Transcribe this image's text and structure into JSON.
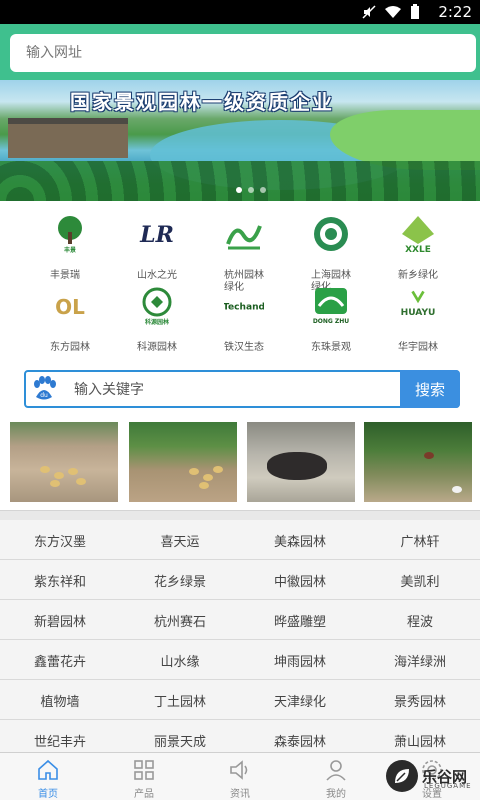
{
  "status_bar": {
    "time": "2:22"
  },
  "url_bar": {
    "placeholder": "输入网址"
  },
  "banner": {
    "title": "国家景观园林一级资质企业"
  },
  "logos": [
    {
      "name": "丰景瑞",
      "mark": "丰景",
      "accent": "#2d8a3a"
    },
    {
      "name": "山水之光",
      "mark": "LR",
      "accent": "#1f2a55"
    },
    {
      "name": "杭州园林绿化",
      "mark": "~",
      "accent": "#3aa14a"
    },
    {
      "name": "上海园林绿化",
      "mark": "",
      "accent": "#2a8c52"
    },
    {
      "name": "新乡绿化",
      "mark": "XXLE",
      "accent": "#2f8a2f"
    },
    {
      "name": "东方园林",
      "mark": "OL",
      "accent": "#c9a24a"
    },
    {
      "name": "科源园林",
      "mark": "科源园林",
      "accent": "#2d8a3a"
    },
    {
      "name": "铁汉生态",
      "mark": "Techand",
      "accent": "#1b5e20"
    },
    {
      "name": "东珠景观",
      "mark": "DONG ZHU",
      "accent": "#2aa046"
    },
    {
      "name": "华宇园林",
      "mark": "HUAYU",
      "accent": "#2f6f2f"
    }
  ],
  "search": {
    "placeholder": "输入关键字",
    "button": "搜索"
  },
  "directory": [
    [
      "东方汉墨",
      "喜天运",
      "美森园林",
      "广林轩"
    ],
    [
      "紫东祥和",
      "花乡绿景",
      "中徽园林",
      "美凯利"
    ],
    [
      "新碧园林",
      "杭州赛石",
      "晔盛雕塑",
      "程波"
    ],
    [
      "鑫蕾花卉",
      "山水缘",
      "坤雨园林",
      "海洋绿洲"
    ],
    [
      "植物墙",
      "丁土园林",
      "天津绿化",
      "景秀园林"
    ],
    [
      "世纪丰卉",
      "丽景天成",
      "森泰园林",
      "萧山园林"
    ]
  ],
  "tabs": [
    {
      "label": "首页",
      "icon": "home-icon",
      "active": true
    },
    {
      "label": "产品",
      "icon": "grid-icon",
      "active": false
    },
    {
      "label": "资讯",
      "icon": "speaker-icon",
      "active": false
    },
    {
      "label": "我的",
      "icon": "person-icon",
      "active": false
    },
    {
      "label": "设置",
      "icon": "gear-icon",
      "active": false
    }
  ],
  "watermark": {
    "text": "乐谷网",
    "sub": "LEGUGAME"
  },
  "colors": {
    "accent_green": "#3fc08e",
    "search_blue": "#3b8fe0",
    "tab_active": "#3a8ee6"
  }
}
